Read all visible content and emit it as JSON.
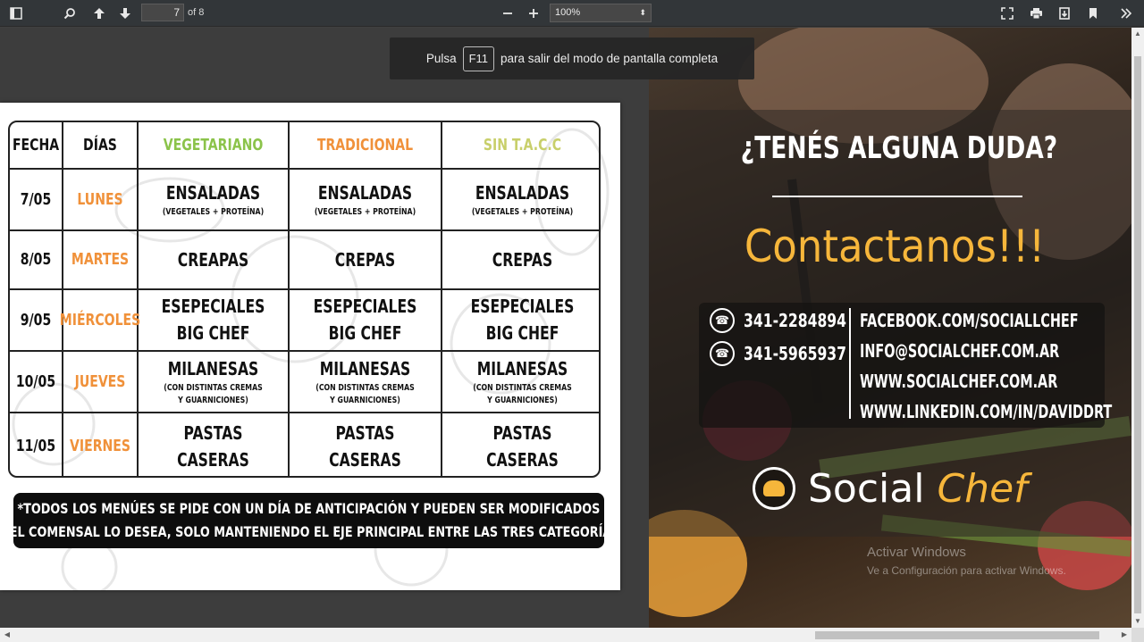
{
  "toolbar": {
    "page_current": "7",
    "page_total": "of 8",
    "zoom": "100%",
    "icons": [
      "sidebar-toggle-icon",
      "search-icon",
      "previous-page-icon",
      "next-page-icon",
      "zoom-out-icon",
      "zoom-in-icon",
      "presentation-mode-icon",
      "print-icon",
      "download-icon",
      "bookmark-icon",
      "tools-icon"
    ]
  },
  "fullscreen_banner": {
    "prefix": "Pulsa",
    "key": "F11",
    "suffix": "para salir del modo de pantalla completa"
  },
  "menu": {
    "headers": {
      "fecha": "FECHA",
      "dias": "DÍAS",
      "vegetariano": "VEGETARIANO",
      "tradicional": "TRADICIONAL",
      "sin_tacc": "SIN T.A.C.C"
    },
    "rows": [
      {
        "date": "7/05",
        "day": "LUNES",
        "veg": {
          "dish": "ENSALADAS",
          "sub1": "(VEGETALES + PROTEÍNA)",
          "sub2": ""
        },
        "trad": {
          "dish": "ENSALADAS",
          "sub1": "(VEGETALES + PROTEÍNA)",
          "sub2": ""
        },
        "sin": {
          "dish": "ENSALADAS",
          "sub1": "(VEGETALES + PROTEÍNA)",
          "sub2": ""
        }
      },
      {
        "date": "8/05",
        "day": "MARTES",
        "veg": {
          "dish": "CREAPAS",
          "dish2": ""
        },
        "trad": {
          "dish": "CREPAS",
          "dish2": ""
        },
        "sin": {
          "dish": "CREPAS",
          "dish2": ""
        }
      },
      {
        "date": "9/05",
        "day": "MIÉRCOLES",
        "veg": {
          "dish": "ESEPECIALES",
          "dish2": "BIG CHEF"
        },
        "trad": {
          "dish": "ESEPECIALES",
          "dish2": "BIG CHEF"
        },
        "sin": {
          "dish": "ESEPECIALES",
          "dish2": "BIG CHEF"
        }
      },
      {
        "date": "10/05",
        "day": "JUEVES",
        "veg": {
          "dish": "MILANESAS",
          "sub1": "(CON DISTINTAS CREMAS",
          "sub2": "Y GUARNICIONES)"
        },
        "trad": {
          "dish": "MILANESAS",
          "sub1": "(CON DISTINTAS CREMAS",
          "sub2": "Y GUARNICIONES)"
        },
        "sin": {
          "dish": "MILANESAS",
          "sub1": "(CON DISTINTAS CREMAS",
          "sub2": "Y GUARNICIONES)"
        }
      },
      {
        "date": "11/05",
        "day": "VIERNES",
        "veg": {
          "dish": "PASTAS CASERAS",
          "dish2": ""
        },
        "trad": {
          "dish": "PASTAS CASERAS",
          "dish2": ""
        },
        "sin": {
          "dish": "PASTAS CASERAS",
          "dish2": ""
        }
      }
    ],
    "notice_line1": "*TODOS LOS MENÚES SE PIDE CON UN DÍA DE ANTICIPACIÓN Y PUEDEN SER MODIFICADOS",
    "notice_line2": "SI EL COMENSAL LO DESEA, SOLO MANTENIENDO EL EJE PRINCIPAL ENTRE LAS TRES CATEGORÍAS."
  },
  "contact": {
    "question": "¿TENÉS ALGUNA DUDA?",
    "title": "Contactanos!!!",
    "phone1": "341-2284894",
    "phone2": "341-5965937",
    "facebook": "FACEBOOK.COM/SOCIALLCHEF",
    "email": "INFO@SOCIALCHEF.COM.AR",
    "website": "WWW.SOCIALCHEF.COM.AR",
    "linkedin": "WWW.LINKEDIN.COM/IN/DAVIDDRT",
    "brand_social": "Social",
    "brand_chef": "Chef"
  },
  "watermark": {
    "line1": "Activar Windows",
    "line2": "Ve a Configuración para activar Windows."
  },
  "colors": {
    "veg": "#8bc34a",
    "trad": "#f0913a",
    "sin": "#c8cf6a",
    "day": "#f0913a",
    "accent": "#f6b63b"
  }
}
